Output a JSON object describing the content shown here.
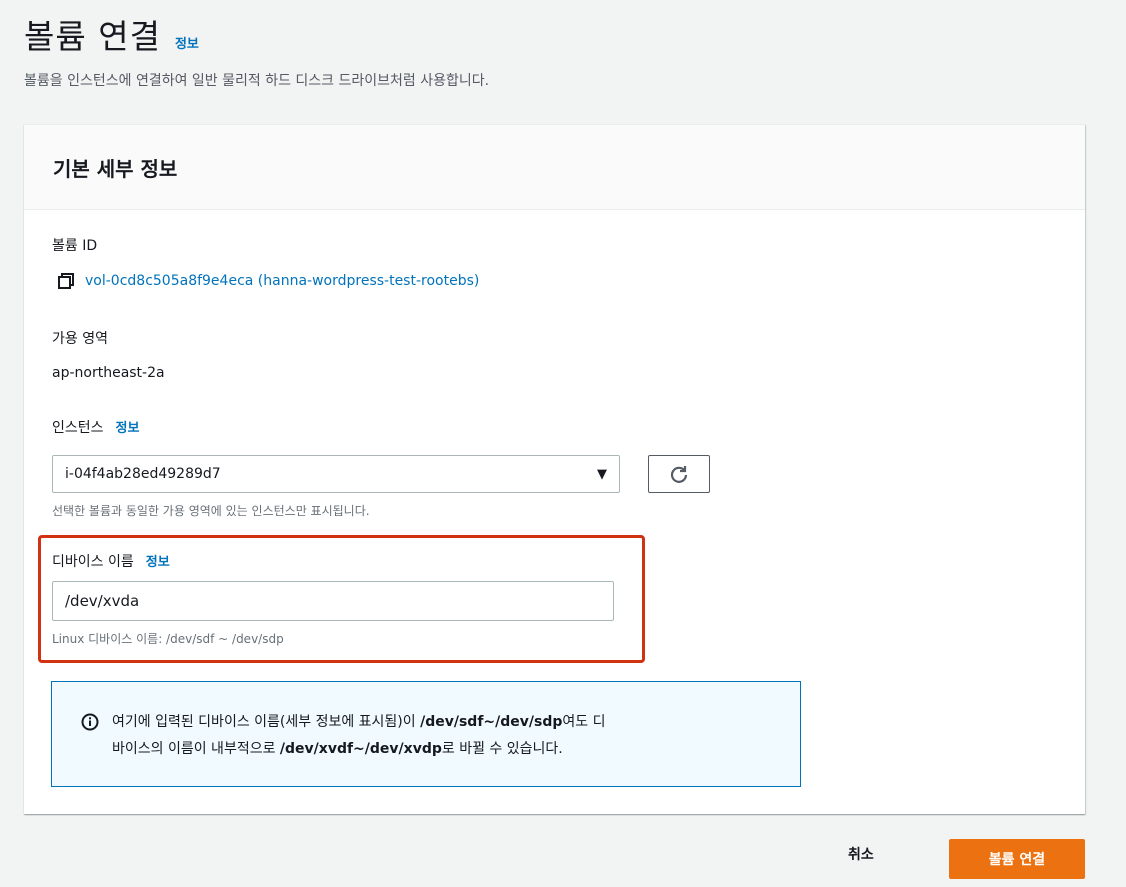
{
  "page": {
    "title": "볼륨 연결",
    "info_link": "정보",
    "description": "볼륨을 인스턴스에 연결하여 일반 물리적 하드 디스크 드라이브처럼 사용합니다."
  },
  "panel": {
    "header": "기본 세부 정보",
    "volume_id": {
      "label": "볼륨 ID",
      "value": "vol-0cd8c505a8f9e4eca (hanna-wordpress-test-rootebs)",
      "icon": "copy-icon"
    },
    "availability_zone": {
      "label": "가용 영역",
      "value": "ap-northeast-2a"
    },
    "instance": {
      "label": "인스턴스",
      "info_link": "정보",
      "selected": "i-04f4ab28ed49289d7",
      "caret": "▼",
      "hint": "선택한 볼륨과 동일한 가용 영역에 있는 인스턴스만 표시됩니다.",
      "refresh_icon": "refresh-icon"
    },
    "device_name": {
      "label": "디바이스 이름",
      "info_link": "정보",
      "value": "/dev/xvda",
      "hint": "Linux 디바이스 이름: /dev/sdf ~ /dev/sdp",
      "highlight_color": "#d13212"
    },
    "alert": {
      "icon": "info-circle-icon",
      "line1_pre": "여기에 입력된 디바이스 이름(세부 정보에 표시됨)이 ",
      "line1_bold": "/dev/sdf~/dev/sdp",
      "line1_post": "여도 디",
      "line2_pre": "바이스의 이름이 내부적으로 ",
      "line2_bold": "/dev/xvdf~/dev/xvdp",
      "line2_post": "로 바뀔 수 있습니다."
    }
  },
  "footer": {
    "cancel_label": "취소",
    "submit_label": "볼륨 연결"
  },
  "colors": {
    "link": "#0073bb",
    "primary": "#ec7211",
    "highlight": "#d13212",
    "alert_bg": "#f1faff"
  }
}
